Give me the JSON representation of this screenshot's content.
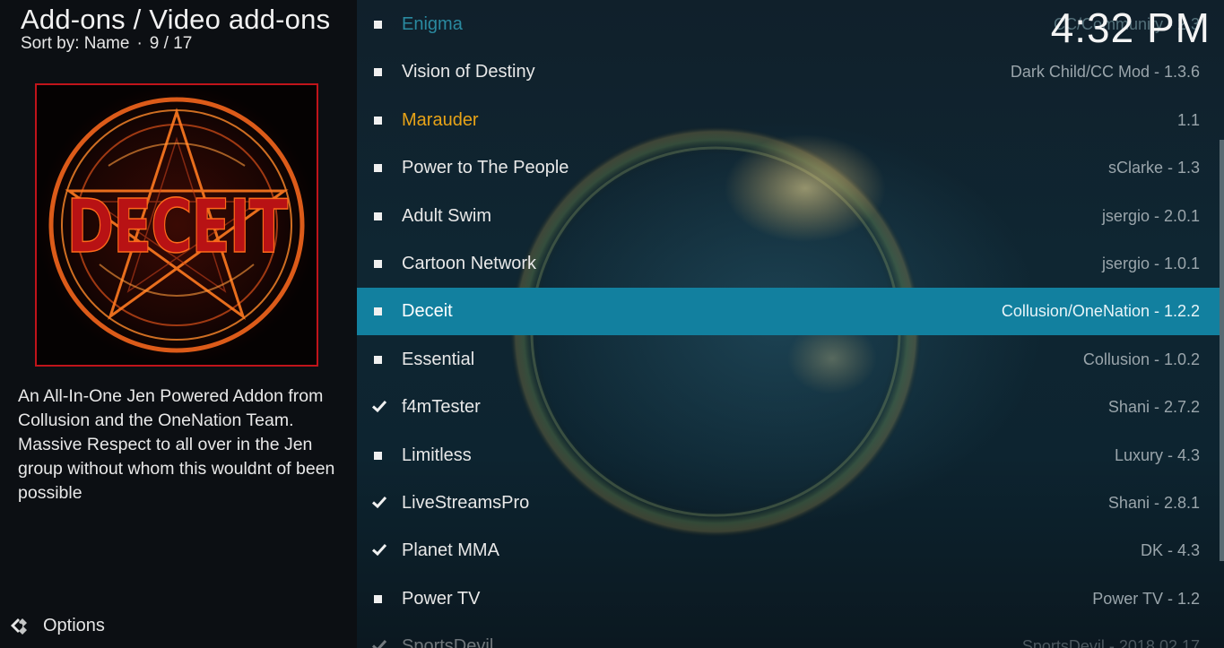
{
  "header": {
    "title": "Add-ons / Video add-ons",
    "sort_label": "Sort by: Name",
    "separator": "·",
    "position": "9 / 17"
  },
  "clock": "4:32 PM",
  "selected_addon": {
    "thumbnail_text": "DECEIT",
    "description": "An All-In-One Jen Powered Addon from Collusion and the OneNation Team. Massive Respect to all over in the Jen group without whom this wouldnt of been possible"
  },
  "options": {
    "label": "Options",
    "icon": "options-icon"
  },
  "addons": [
    {
      "name": "Enigma",
      "version": "CC/Community - 2.3",
      "marker": "bullet",
      "state": "top-faded"
    },
    {
      "name": "Vision of Destiny",
      "version": "Dark Child/CC Mod - 1.3.6",
      "marker": "bullet",
      "state": "normal"
    },
    {
      "name": "Marauder",
      "version": "1.1",
      "marker": "bullet",
      "state": "highlight"
    },
    {
      "name": "Power to The People",
      "version": "sClarke - 1.3",
      "marker": "bullet",
      "state": "normal"
    },
    {
      "name": "Adult Swim",
      "version": "jsergio - 2.0.1",
      "marker": "bullet",
      "state": "normal"
    },
    {
      "name": "Cartoon Network",
      "version": "jsergio - 1.0.1",
      "marker": "bullet",
      "state": "normal"
    },
    {
      "name": "Deceit",
      "version": "Collusion/OneNation - 1.2.2",
      "marker": "bullet",
      "state": "selected"
    },
    {
      "name": "Essential",
      "version": "Collusion - 1.0.2",
      "marker": "bullet",
      "state": "normal"
    },
    {
      "name": "f4mTester",
      "version": "Shani - 2.7.2",
      "marker": "check",
      "state": "normal"
    },
    {
      "name": "Limitless",
      "version": "Luxury - 4.3",
      "marker": "bullet",
      "state": "normal"
    },
    {
      "name": "LiveStreamsPro",
      "version": "Shani - 2.8.1",
      "marker": "check",
      "state": "normal"
    },
    {
      "name": "Planet MMA",
      "version": "DK - 4.3",
      "marker": "check",
      "state": "normal"
    },
    {
      "name": "Power TV",
      "version": "Power TV - 1.2",
      "marker": "bullet",
      "state": "normal"
    },
    {
      "name": "SportsDevil",
      "version": "SportsDevil - 2018.02.17",
      "marker": "check",
      "state": "faded"
    }
  ],
  "colors": {
    "selected_row": "#12809f",
    "highlight_text": "#e8a317",
    "thumbnail_border": "#c0141a"
  }
}
